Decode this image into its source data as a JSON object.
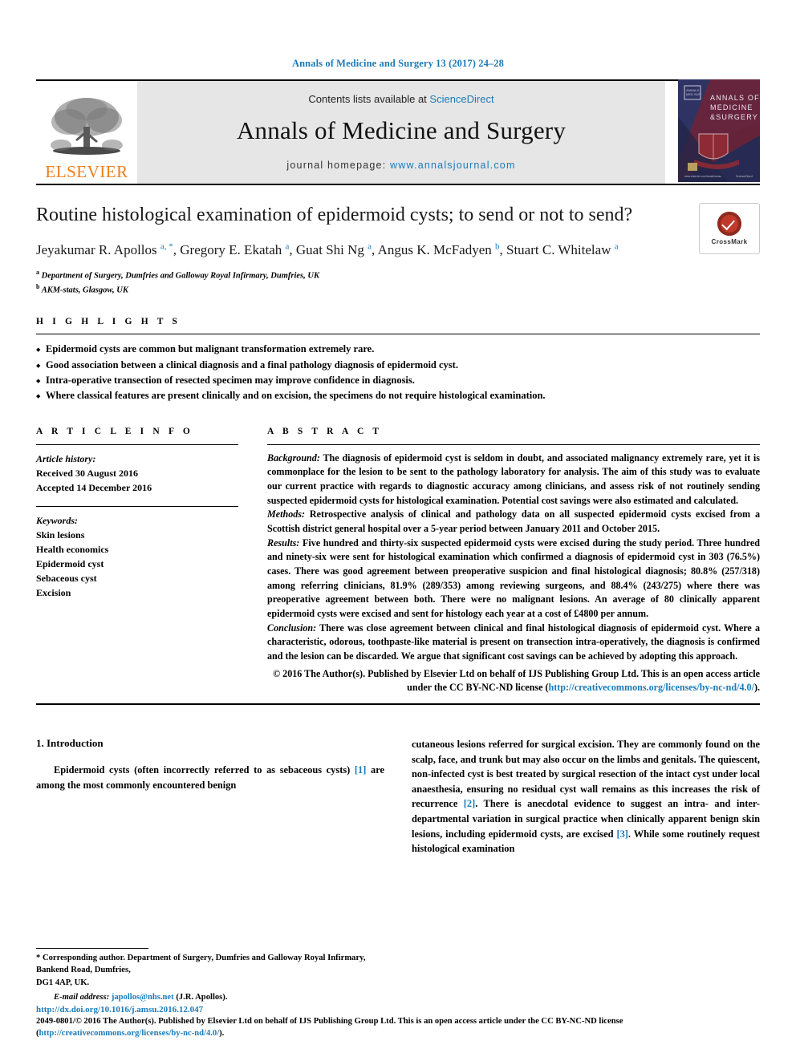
{
  "running_head": "Annals of Medicine and Surgery 13 (2017) 24–28",
  "masthead": {
    "publisher_name": "ELSEVIER",
    "contents_prefix": "Contents lists available at ",
    "contents_link": "ScienceDirect",
    "journal_title": "Annals of Medicine and Surgery",
    "homepage_label": "journal homepage: ",
    "homepage_url": "www.annalsjournal.com",
    "cover_title_line1": "ANNALS OF",
    "cover_title_line2": "MEDICINE",
    "cover_title_line3": "& SURGERY"
  },
  "article": {
    "title": "Routine histological examination of epidermoid cysts; to send or not to send?",
    "authors_html": "Jeyakumar R. Apollos <sup>a, *</sup>, Gregory E. Ekatah <sup>a</sup>, Guat Shi Ng <sup>a</sup>, Angus K. McFadyen <sup>b</sup>, Stuart C. Whitelaw <sup>a</sup>",
    "affiliation_a": "Department of Surgery, Dumfries and Galloway Royal Infirmary, Dumfries, UK",
    "affiliation_b": "AKM-stats, Glasgow, UK",
    "crossmark_label": "CrossMark"
  },
  "highlights": {
    "heading": "H I G H L I G H T S",
    "items": [
      "Epidermoid cysts are common but malignant transformation extremely rare.",
      "Good association between a clinical diagnosis and a final pathology diagnosis of epidermoid cyst.",
      "Intra-operative transection of resected specimen may improve confidence in diagnosis.",
      "Where classical features are present clinically and on excision, the specimens do not require histological examination."
    ]
  },
  "article_info": {
    "heading": "A R T I C L E  I N F O",
    "history_label": "Article history:",
    "received": "Received 30 August 2016",
    "accepted": "Accepted 14 December 2016",
    "keywords_label": "Keywords:",
    "keywords": [
      "Skin lesions",
      "Health economics",
      "Epidermoid cyst",
      "Sebaceous cyst",
      "Excision"
    ]
  },
  "abstract": {
    "heading": "A B S T R A C T",
    "background_label": "Background:",
    "background": " The diagnosis of epidermoid cyst is seldom in doubt, and associated malignancy extremely rare, yet it is commonplace for the lesion to be sent to the pathology laboratory for analysis. The aim of this study was to evaluate our current practice with regards to diagnostic accuracy among clinicians, and assess risk of not routinely sending suspected epidermoid cysts for histological examination. Potential cost savings were also estimated and calculated.",
    "methods_label": "Methods:",
    "methods": " Retrospective analysis of clinical and pathology data on all suspected epidermoid cysts excised from a Scottish district general hospital over a 5-year period between January 2011 and October 2015.",
    "results_label": "Results:",
    "results": " Five hundred and thirty-six suspected epidermoid cysts were excised during the study period. Three hundred and ninety-six were sent for histological examination which confirmed a diagnosis of epidermoid cyst in 303 (76.5%) cases. There was good agreement between preoperative suspicion and final histological diagnosis; 80.8% (257/318) among referring clinicians, 81.9% (289/353) among reviewing surgeons, and 88.4% (243/275) where there was preoperative agreement between both. There were no malignant lesions. An average of 80 clinically apparent epidermoid cysts were excised and sent for histology each year at a cost of £4800 per annum.",
    "conclusion_label": "Conclusion:",
    "conclusion": " There was close agreement between clinical and final histological diagnosis of epidermoid cyst. Where a characteristic, odorous, toothpaste-like material is present on transection intra-operatively, the diagnosis is confirmed and the lesion can be discarded. We argue that significant cost savings can be achieved by adopting this approach.",
    "copyright": "© 2016 The Author(s). Published by Elsevier Ltd on behalf of IJS Publishing Group Ltd. This is an open access article under the CC BY-NC-ND license (",
    "copyright_link": "http://creativecommons.org/licenses/by-nc-nd/4.0/",
    "copyright_tail": ")."
  },
  "introduction": {
    "heading": "1. Introduction",
    "left_para_a": "Epidermoid cysts (often incorrectly referred to as sebaceous cysts) ",
    "left_ref_1": "[1]",
    "left_para_b": " are among the most commonly encountered benign",
    "right_para_a": "cutaneous lesions referred for surgical excision. They are commonly found on the scalp, face, and trunk but may also occur on the limbs and genitals. The quiescent, non-infected cyst is best treated by surgical resection of the intact cyst under local anaesthesia, ensuring no residual cyst wall remains as this increases the risk of recurrence ",
    "right_ref_2": "[2]",
    "right_para_b": ". There is anecdotal evidence to suggest an intra- and inter-departmental variation in surgical practice when clinically apparent benign skin lesions, including epidermoid cysts, are excised ",
    "right_ref_3": "[3]",
    "right_para_c": ". While some routinely request histological examination"
  },
  "footnotes": {
    "corresponding": "* Corresponding author. Department of Surgery, Dumfries and Galloway Royal Infirmary, Bankend Road, Dumfries,",
    "postcode": "DG1 4AP, UK.",
    "email_label": "E-mail address: ",
    "email": "japollos@nhs.net",
    "email_owner": " (J.R. Apollos)."
  },
  "page_footer": {
    "doi": "http://dx.doi.org/10.1016/j.amsu.2016.12.047",
    "issn_copy": "2049-0801/© 2016 The Author(s). Published by Elsevier Ltd on behalf of IJS Publishing Group Ltd. This is an open access article under the CC BY-NC-ND license (",
    "license_link_a": "http://",
    "license_link_b": "creativecommons.org/licenses/by-nc-nd/4.0/",
    "copy_tail": ")."
  },
  "colors": {
    "link": "#1a7bb9",
    "elsevier_orange": "#ef7d1a",
    "crossmark_red": "#c0392b"
  }
}
